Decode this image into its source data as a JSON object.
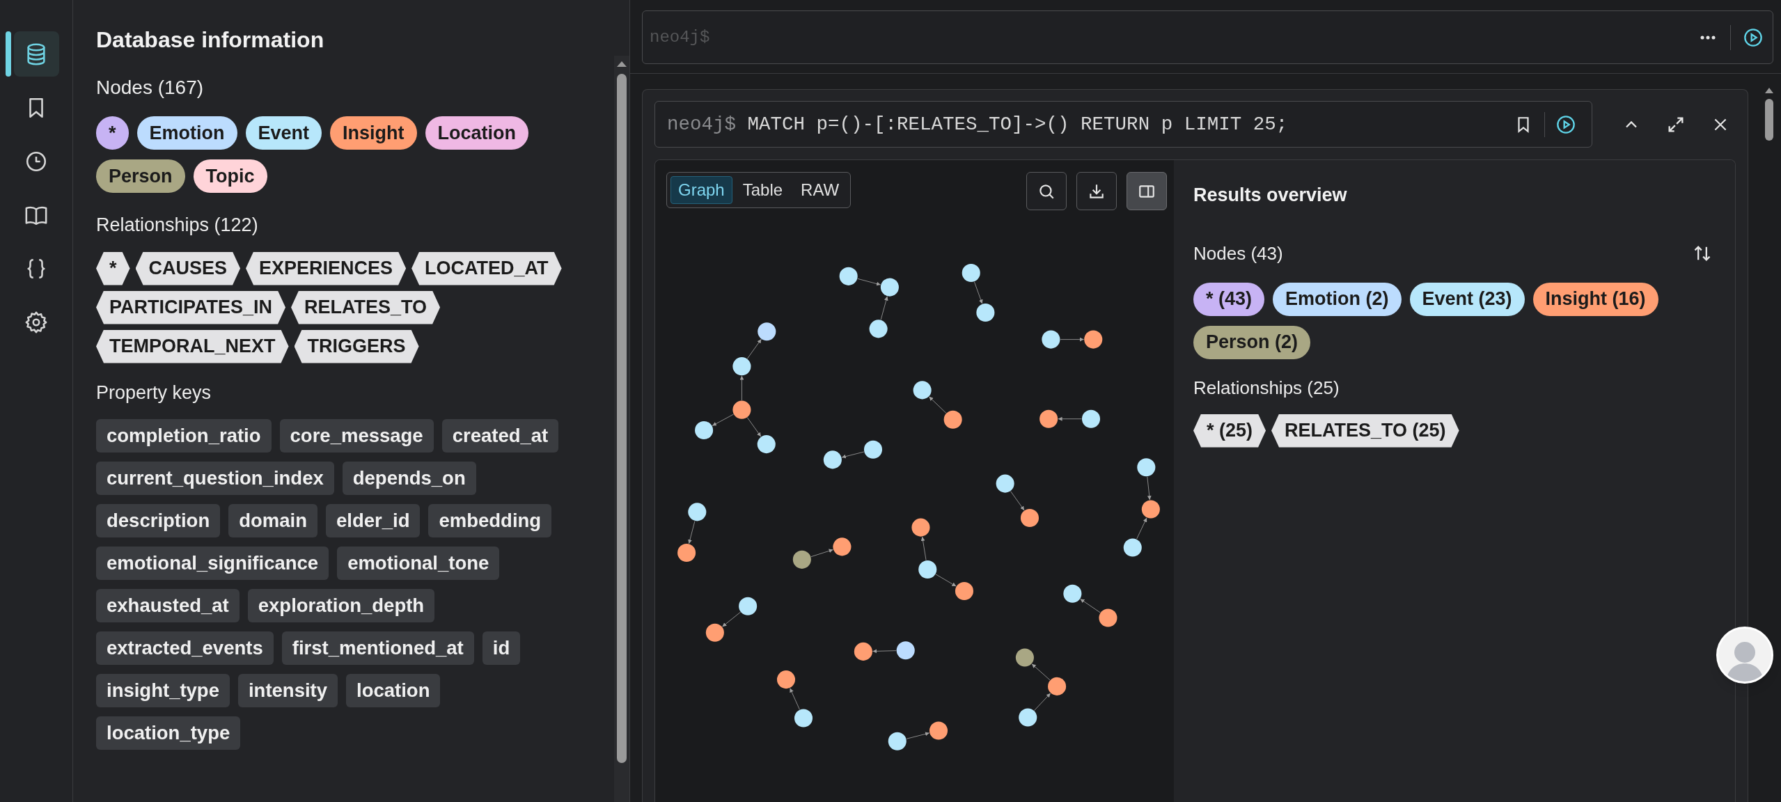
{
  "sidebar_nav": [
    {
      "kind": "database",
      "selected": true
    },
    {
      "kind": "bookmark",
      "selected": false
    },
    {
      "kind": "history",
      "selected": false
    },
    {
      "kind": "book",
      "selected": false
    },
    {
      "kind": "braces",
      "selected": false
    },
    {
      "kind": "settings",
      "selected": false
    }
  ],
  "database_info": {
    "title": "Database information",
    "nodes_heading": "Nodes (167)",
    "node_labels": [
      {
        "label": "*",
        "color": "#c7b3f4"
      },
      {
        "label": "Emotion",
        "color": "#bcdcfe"
      },
      {
        "label": "Event",
        "color": "#b7e7fb"
      },
      {
        "label": "Insight",
        "color": "#ff9e72"
      },
      {
        "label": "Location",
        "color": "#efb8e4"
      },
      {
        "label": "Person",
        "color": "#a9a784"
      },
      {
        "label": "Topic",
        "color": "#ffd4d9"
      }
    ],
    "relationships_heading": "Relationships (122)",
    "relationship_types": [
      "*",
      "CAUSES",
      "EXPERIENCES",
      "LOCATED_AT",
      "PARTICIPATES_IN",
      "RELATES_TO",
      "TEMPORAL_NEXT",
      "TRIGGERS"
    ],
    "property_keys_heading": "Property keys",
    "property_keys": [
      "completion_ratio",
      "core_message",
      "created_at",
      "current_question_index",
      "depends_on",
      "description",
      "domain",
      "elder_id",
      "embedding",
      "emotional_significance",
      "emotional_tone",
      "exhausted_at",
      "exploration_depth",
      "extracted_events",
      "first_mentioned_at",
      "id",
      "insight_type",
      "intensity",
      "location",
      "location_type"
    ]
  },
  "editor": {
    "placeholder": "neo4j$"
  },
  "result_frame": {
    "prompt": "neo4j$",
    "query": "MATCH p=()-[:RELATES_TO]->() RETURN p LIMIT 25;",
    "view_tabs": [
      {
        "label": "Graph",
        "selected": true
      },
      {
        "label": "Table",
        "selected": false
      },
      {
        "label": "RAW",
        "selected": false
      }
    ],
    "overview_panel_open": true,
    "results_overview": {
      "title": "Results overview",
      "nodes_heading": "Nodes (43)",
      "node_labels": [
        {
          "label": "* (43)",
          "color": "#c7b3f4"
        },
        {
          "label": "Emotion (2)",
          "color": "#bcdcfe"
        },
        {
          "label": "Event (23)",
          "color": "#b7e7fb"
        },
        {
          "label": "Insight (16)",
          "color": "#ff9e72"
        },
        {
          "label": "Person (2)",
          "color": "#a9a784"
        }
      ],
      "relationships_heading": "Relationships (25)",
      "relationship_types": [
        "* (25)",
        "RELATES_TO (25)"
      ]
    }
  }
}
